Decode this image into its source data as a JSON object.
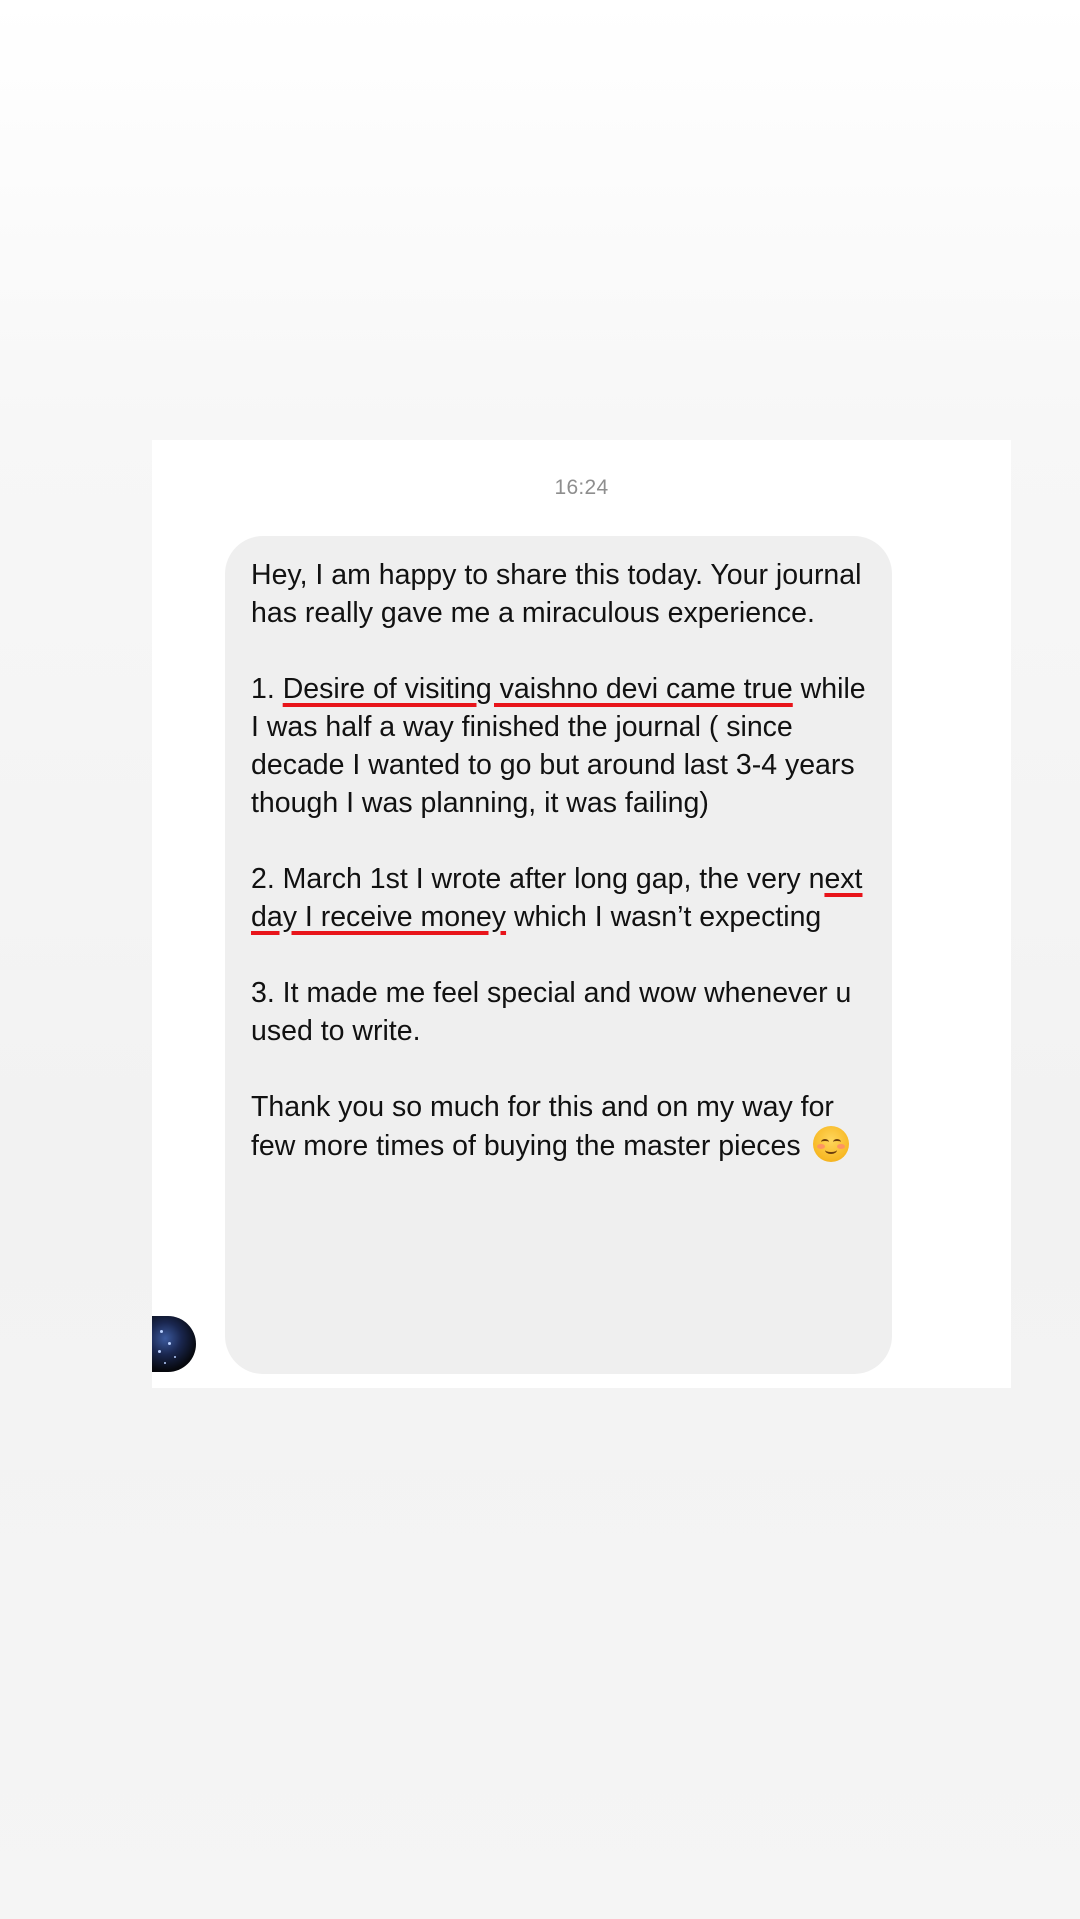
{
  "conversation": {
    "timestamp": "16:24",
    "message": {
      "intro": "Hey, I am happy to share this today. Your journal has really gave me a miraculous experience.",
      "point1_prefix": "1. ",
      "point1_highlight": "Desire of visiting vaishno devi came true",
      "point1_rest": " while I was half a way finished the journal ( since decade I wanted to go but around last 3-4 years though I was planning, it was failing)",
      "point2_prefix": "2. March 1st I wrote after long gap, the very n",
      "point2_highlight": "ext day I receive money",
      "point2_rest": " which I wasn’t expecting",
      "point3": "3. It made me feel special and wow whenever u used to write.",
      "closing": "Thank you so much for this and on my way for few more times of buying the master pieces ",
      "closing_emoji": "smiling-face-with-blush-emoji"
    },
    "sender_avatar": "starry-night-avatar",
    "highlight_color": "#e8141a",
    "bubble_color": "#efefef"
  }
}
